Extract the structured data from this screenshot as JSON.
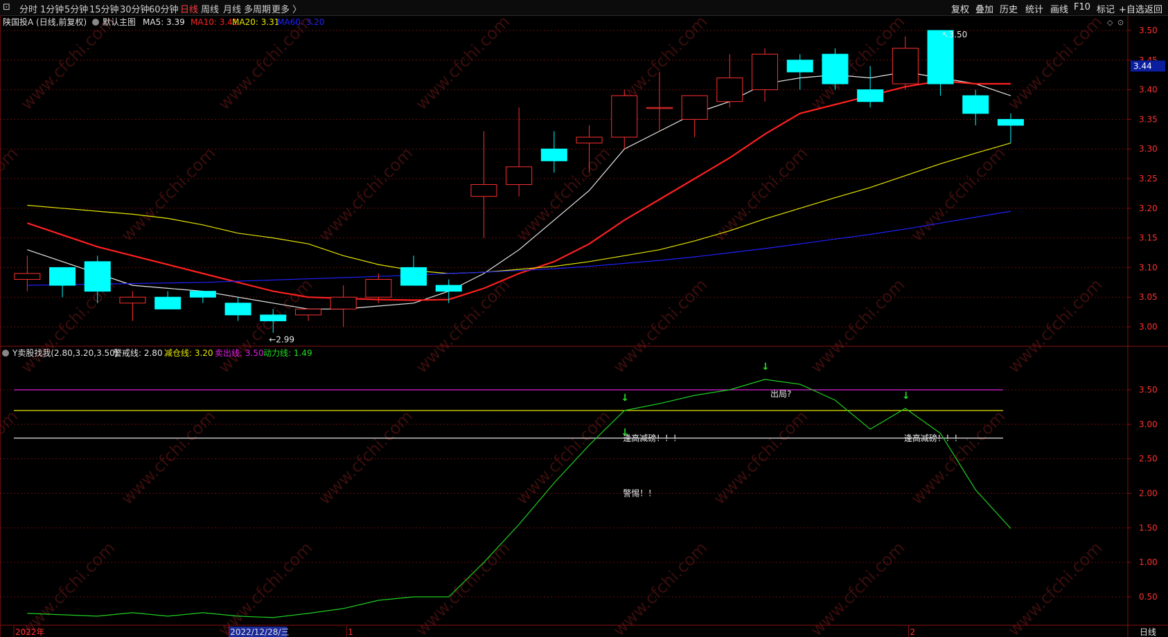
{
  "toolbar": {
    "left_items": [
      "分时",
      "1分钟",
      "5分钟",
      "15分钟",
      "30分钟",
      "60分钟",
      "日线",
      "周线",
      "月线",
      "多周期",
      "更多 〉"
    ],
    "active_index": 6,
    "right_items": [
      "复权",
      "叠加",
      "历史",
      "统计",
      "画线",
      "F10",
      "标记",
      "+自选",
      "返回"
    ]
  },
  "main_header": {
    "stock": "陕国投A (日线,前复权)",
    "chart_name": "默认主图",
    "ma_labels": [
      {
        "text": "MA5: 3.39",
        "color": "#e8e8e8"
      },
      {
        "text": "MA10: 3.41",
        "color": "#ff2020"
      },
      {
        "text": "MA20: 3.31",
        "color": "#e8e800"
      },
      {
        "text": "MA60: 3.20",
        "color": "#2020ff"
      }
    ]
  },
  "price_tag": "3.44",
  "high_label": "3.50",
  "low_label": "2.99",
  "sub_header": {
    "name": "Y卖股找我(2.80,3.20,3.50)",
    "labels": [
      {
        "text": "警戒线: 2.80",
        "color": "#e8e8e8"
      },
      {
        "text": "减仓线: 3.20",
        "color": "#e8e800"
      },
      {
        "text": "卖出线: 3.50",
        "color": "#e020e0"
      },
      {
        "text": "动力线: 1.49",
        "color": "#20e020"
      }
    ]
  },
  "annotations": [
    {
      "text": "出局?",
      "x_index": 21,
      "value": 3.44
    },
    {
      "text": "逢高减磅！！！",
      "x_index": 17,
      "value": 2.8
    },
    {
      "text": "逢高减磅！！！",
      "x_index": 25,
      "value": 2.8
    },
    {
      "text": "警惕！！",
      "x_index": 17,
      "value": 2.0
    }
  ],
  "xaxis_labels": [
    {
      "text": "2022年",
      "x_index": 0,
      "color": "#ff3030"
    },
    {
      "text": "2022/12/28/三",
      "x_index": 6,
      "color": "#e0e0e0",
      "highlight": true
    },
    {
      "text": "1",
      "x_index": 9,
      "color": "#ff3030"
    },
    {
      "text": "2",
      "x_index": 25,
      "color": "#ff3030"
    }
  ],
  "period_label": "日线",
  "watermark": "www.cfchi.com",
  "chart_data": [
    {
      "type": "candlestick",
      "ylim": [
        2.96,
        3.52
      ],
      "yticks": [
        3.0,
        3.05,
        3.1,
        3.15,
        3.2,
        3.25,
        3.3,
        3.35,
        3.4,
        3.45,
        3.5
      ],
      "candles": [
        {
          "o": 3.08,
          "h": 3.12,
          "l": 3.06,
          "c": 3.09
        },
        {
          "o": 3.1,
          "h": 3.1,
          "l": 3.05,
          "c": 3.07
        },
        {
          "o": 3.11,
          "h": 3.12,
          "l": 3.04,
          "c": 3.06
        },
        {
          "o": 3.04,
          "h": 3.06,
          "l": 3.01,
          "c": 3.05
        },
        {
          "o": 3.05,
          "h": 3.06,
          "l": 3.03,
          "c": 3.03
        },
        {
          "o": 3.06,
          "h": 3.06,
          "l": 3.04,
          "c": 3.05
        },
        {
          "o": 3.04,
          "h": 3.05,
          "l": 3.01,
          "c": 3.02
        },
        {
          "o": 3.02,
          "h": 3.03,
          "l": 2.99,
          "c": 3.01
        },
        {
          "o": 3.02,
          "h": 3.03,
          "l": 3.01,
          "c": 3.03
        },
        {
          "o": 3.03,
          "h": 3.07,
          "l": 3.0,
          "c": 3.05
        },
        {
          "o": 3.05,
          "h": 3.09,
          "l": 3.04,
          "c": 3.08
        },
        {
          "o": 3.1,
          "h": 3.12,
          "l": 3.07,
          "c": 3.07
        },
        {
          "o": 3.07,
          "h": 3.08,
          "l": 3.04,
          "c": 3.06
        },
        {
          "o": 3.22,
          "h": 3.33,
          "l": 3.15,
          "c": 3.24
        },
        {
          "o": 3.24,
          "h": 3.37,
          "l": 3.22,
          "c": 3.27
        },
        {
          "o": 3.3,
          "h": 3.33,
          "l": 3.26,
          "c": 3.28
        },
        {
          "o": 3.31,
          "h": 3.34,
          "l": 3.26,
          "c": 3.32
        },
        {
          "o": 3.32,
          "h": 3.4,
          "l": 3.3,
          "c": 3.39
        },
        {
          "o": 3.37,
          "h": 3.43,
          "l": 3.33,
          "c": 3.37
        },
        {
          "o": 3.35,
          "h": 3.39,
          "l": 3.32,
          "c": 3.39
        },
        {
          "o": 3.38,
          "h": 3.46,
          "l": 3.37,
          "c": 3.42
        },
        {
          "o": 3.4,
          "h": 3.47,
          "l": 3.38,
          "c": 3.46
        },
        {
          "o": 3.45,
          "h": 3.46,
          "l": 3.4,
          "c": 3.43
        },
        {
          "o": 3.46,
          "h": 3.47,
          "l": 3.4,
          "c": 3.41
        },
        {
          "o": 3.4,
          "h": 3.44,
          "l": 3.37,
          "c": 3.38
        },
        {
          "o": 3.41,
          "h": 3.49,
          "l": 3.4,
          "c": 3.47
        },
        {
          "o": 3.5,
          "h": 3.5,
          "l": 3.39,
          "c": 3.41
        },
        {
          "o": 3.39,
          "h": 3.4,
          "l": 3.34,
          "c": 3.36
        },
        {
          "o": 3.35,
          "h": 3.36,
          "l": 3.31,
          "c": 3.34
        }
      ],
      "series": [
        {
          "name": "MA5",
          "color": "#e8e8e8",
          "width": 1.2,
          "values": [
            3.13,
            3.11,
            3.09,
            3.07,
            3.065,
            3.06,
            3.05,
            3.04,
            3.03,
            3.03,
            3.035,
            3.04,
            3.06,
            3.09,
            3.13,
            3.18,
            3.23,
            3.3,
            3.33,
            3.36,
            3.38,
            3.41,
            3.42,
            3.425,
            3.42,
            3.43,
            3.42,
            3.41,
            3.39
          ]
        },
        {
          "name": "MA10",
          "color": "#ff2020",
          "width": 2.2,
          "values": [
            3.175,
            3.155,
            3.135,
            3.12,
            3.105,
            3.09,
            3.075,
            3.06,
            3.05,
            3.048,
            3.046,
            3.045,
            3.046,
            3.065,
            3.09,
            3.11,
            3.14,
            3.18,
            3.215,
            3.25,
            3.285,
            3.325,
            3.36,
            3.375,
            3.39,
            3.405,
            3.415,
            3.41,
            3.41
          ]
        },
        {
          "name": "MA20",
          "color": "#e8e800",
          "width": 1.2,
          "values": [
            3.205,
            3.2,
            3.195,
            3.19,
            3.183,
            3.172,
            3.158,
            3.15,
            3.14,
            3.12,
            3.105,
            3.095,
            3.09,
            3.092,
            3.097,
            3.102,
            3.11,
            3.12,
            3.13,
            3.145,
            3.162,
            3.182,
            3.2,
            3.218,
            3.235,
            3.255,
            3.275,
            3.293,
            3.31
          ]
        },
        {
          "name": "MA60",
          "color": "#2020ff",
          "width": 1.2,
          "values": [
            3.07,
            3.071,
            3.072,
            3.073,
            3.074,
            3.075,
            3.077,
            3.079,
            3.081,
            3.083,
            3.085,
            3.087,
            3.09,
            3.092,
            3.095,
            3.098,
            3.102,
            3.107,
            3.112,
            3.118,
            3.125,
            3.132,
            3.14,
            3.148,
            3.156,
            3.165,
            3.175,
            3.185,
            3.195
          ]
        }
      ]
    },
    {
      "type": "line",
      "ylim": [
        0.2,
        3.95
      ],
      "yticks": [
        0.5,
        1.0,
        1.5,
        2.0,
        2.5,
        3.0,
        3.5
      ],
      "hlines": [
        {
          "name": "卖出线",
          "value": 3.5,
          "color": "#e020e0"
        },
        {
          "name": "减仓线",
          "value": 3.2,
          "color": "#e8e800"
        },
        {
          "name": "警戒线",
          "value": 2.8,
          "color": "#e8e8e8"
        }
      ],
      "series": [
        {
          "name": "动力线",
          "color": "#20d020",
          "values": [
            0.26,
            0.24,
            0.22,
            0.27,
            0.22,
            0.27,
            0.22,
            0.2,
            0.26,
            0.33,
            0.45,
            0.5,
            0.5,
            1.0,
            1.55,
            2.15,
            2.7,
            3.2,
            3.3,
            3.42,
            3.5,
            3.65,
            3.58,
            3.35,
            2.93,
            3.23,
            2.87,
            2.05,
            1.49
          ]
        }
      ],
      "sell_arrows": [
        17,
        21,
        25
      ],
      "buy_arrows": [
        17
      ]
    }
  ]
}
